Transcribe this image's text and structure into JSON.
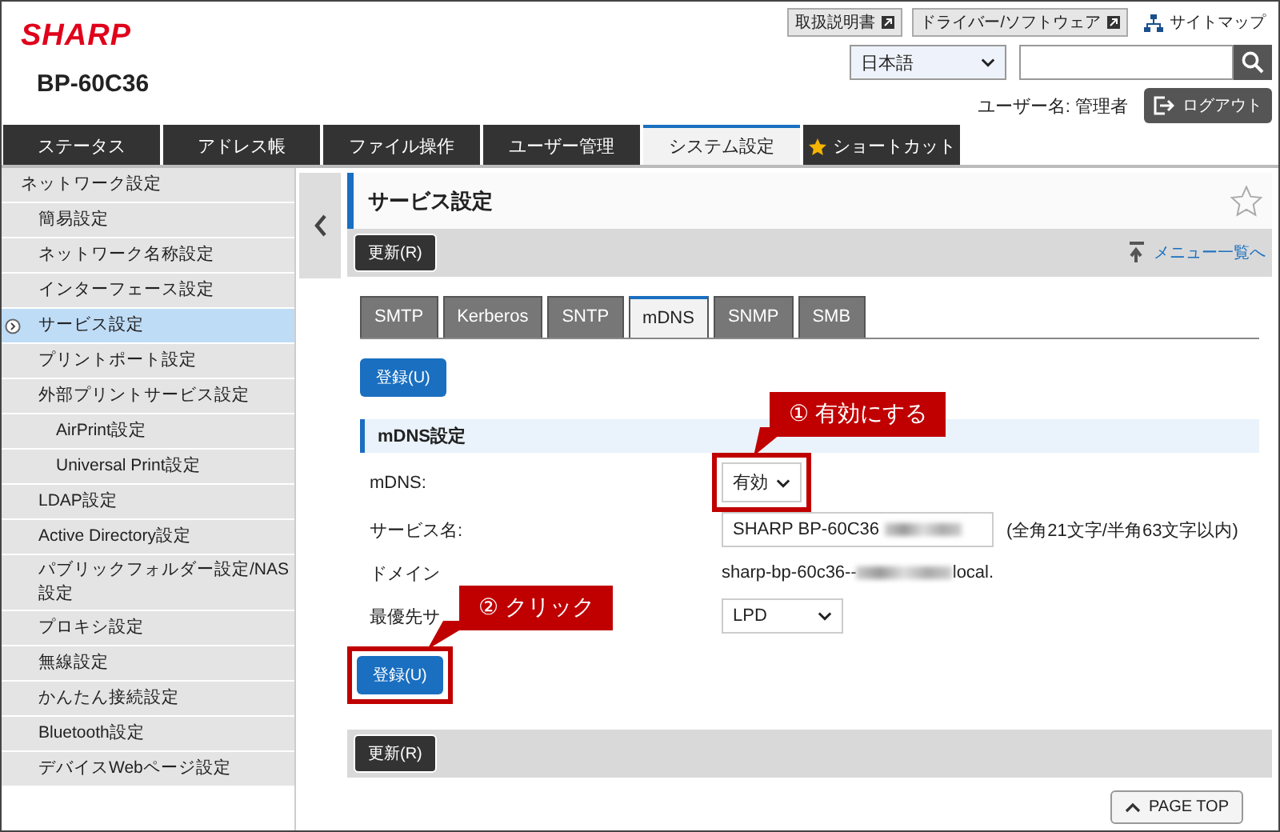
{
  "header": {
    "logo": "SHARP",
    "model": "BP-60C36",
    "links": [
      {
        "label": "取扱説明書",
        "kind": "external"
      },
      {
        "label": "ドライバー/ソフトウェア",
        "kind": "external"
      },
      {
        "label": "サイトマップ",
        "kind": "sitemap"
      }
    ],
    "language": "日本語",
    "user_label": "ユーザー名: 管理者",
    "logout": "ログアウト"
  },
  "tabs": [
    {
      "label": "ステータス",
      "selected": false
    },
    {
      "label": "アドレス帳",
      "selected": false
    },
    {
      "label": "ファイル操作",
      "selected": false
    },
    {
      "label": "ユーザー管理",
      "selected": false
    },
    {
      "label": "システム設定",
      "selected": true
    },
    {
      "label": "ショートカット",
      "selected": false,
      "kind": "shortcut"
    }
  ],
  "sidebar": {
    "items": [
      {
        "label": "ネットワーク設定",
        "selected": false,
        "children": [
          {
            "label": "簡易設定",
            "selected": false
          },
          {
            "label": "ネットワーク名称設定",
            "selected": false
          },
          {
            "label": "インターフェース設定",
            "selected": false
          },
          {
            "label": "サービス設定",
            "selected": true
          },
          {
            "label": "プリントポート設定",
            "selected": false
          },
          {
            "label": "外部プリントサービス設定",
            "selected": false,
            "children": [
              {
                "label": "AirPrint設定",
                "selected": false
              },
              {
                "label": "Universal Print設定",
                "selected": false
              }
            ]
          },
          {
            "label": "LDAP設定",
            "selected": false
          },
          {
            "label": "Active Directory設定",
            "selected": false
          },
          {
            "label": "パブリックフォルダー設定/NAS設定",
            "selected": false
          },
          {
            "label": "プロキシ設定",
            "selected": false
          },
          {
            "label": "無線設定",
            "selected": false
          },
          {
            "label": "かんたん接続設定",
            "selected": false
          },
          {
            "label": "Bluetooth設定",
            "selected": false
          },
          {
            "label": "デバイスWebページ設定",
            "selected": false
          }
        ]
      }
    ]
  },
  "page": {
    "title": "サービス設定",
    "refresh": "更新(R)",
    "menu_link": "メニュー一覧へ",
    "subtabs": [
      {
        "label": "SMTP",
        "selected": false
      },
      {
        "label": "Kerberos",
        "selected": false
      },
      {
        "label": "SNTP",
        "selected": false
      },
      {
        "label": "mDNS",
        "selected": true
      },
      {
        "label": "SNMP",
        "selected": false
      },
      {
        "label": "SMB",
        "selected": false
      }
    ],
    "register": "登録(U)",
    "section": "mDNS設定",
    "fields": [
      {
        "label": "mDNS:",
        "kind": "select",
        "value": "有効",
        "annotation": "① 有効にする"
      },
      {
        "label": "サービス名:",
        "kind": "text",
        "value": "SHARP BP-60C36",
        "note": "(全角21文字/半角63文字以内)"
      },
      {
        "label": "ドメイン",
        "kind": "static",
        "value": "sharp-bp-60c36--",
        "value_end": "local."
      },
      {
        "label": "最優先サ",
        "kind": "select",
        "value": "LPD"
      }
    ],
    "register_bottom": {
      "label": "登録(U)",
      "annotation": "② クリック"
    },
    "refresh_bottom": "更新(R)",
    "page_top": "PAGE TOP"
  }
}
